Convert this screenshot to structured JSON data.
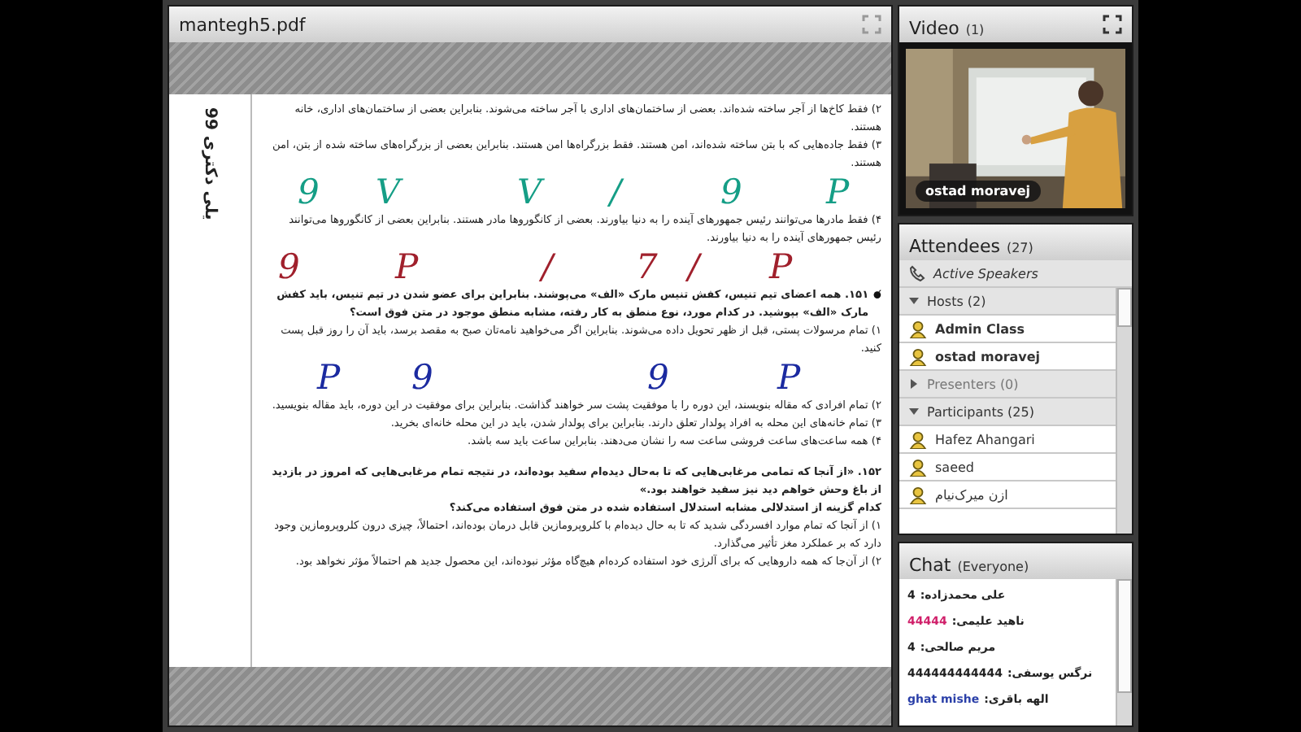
{
  "document": {
    "title": "mantegh5.pdf",
    "side_label": "یلی دکتری 99",
    "lines": [
      {
        "kind": "plain",
        "text": "۲) فقط کاخ‌ها از آجر ساخته شده‌اند. بعضی از ساختمان‌های اداری با آجر ساخته می‌شوند. بنابراین بعضی از ساختمان‌های اداری، خانه هستند."
      },
      {
        "kind": "plain",
        "text": "۳) فقط جاده‌هایی که با بتن ساخته شده‌اند، امن هستند. فقط بزرگراه‌ها امن هستند. بنابراین بعضی از بزرگراه‌های ساخته شده از بتن، امن هستند."
      },
      {
        "kind": "ink",
        "marks": [
          {
            "text": "P",
            "color": "#159e86"
          },
          {
            "text": "9",
            "color": "#159e86"
          },
          {
            "text": "/",
            "color": "#159e86"
          },
          {
            "text": "V",
            "color": "#159e86"
          },
          {
            "text": "V",
            "color": "#159e86"
          },
          {
            "text": "9",
            "color": "#159e86"
          }
        ]
      },
      {
        "kind": "plain",
        "text": "۴) فقط مادرها می‌توانند رئیس جمهورهای آینده را به دنیا بیاورند. بعضی از کانگوروها مادر هستند. بنابراین بعضی از کانگوروها می‌توانند رئیس جمهورهای آینده را به دنیا بیاورند."
      },
      {
        "kind": "ink",
        "marks": [
          {
            "text": "P",
            "color": "#a0202c"
          },
          {
            "text": "/",
            "color": "#a0202c"
          },
          {
            "text": "7",
            "color": "#a0202c"
          },
          {
            "text": "/",
            "color": "#a0202c"
          },
          {
            "text": "P",
            "color": "#a0202c"
          },
          {
            "text": "9",
            "color": "#a0202c"
          }
        ]
      },
      {
        "kind": "question",
        "text": "۱۵۱. همه اعضای تیم تنیس، کفش تنیس مارک «الف» می‌پوشند. بنابراین برای عضو شدن در تیم تنیس، باید کفش مارک «الف» بپوشید. در کدام مورد، نوع منطق به کار رفته، مشابه منطق موجود در متن فوق است؟"
      },
      {
        "kind": "plain",
        "text": "۱) تمام مرسولات پستی، قبل از ظهر تحویل داده می‌شوند. بنابراین اگر می‌خواهید نامه‌تان صبح به مقصد برسد، باید آن را روز قبل پست کنید."
      },
      {
        "kind": "ink",
        "marks": [
          {
            "text": "P",
            "color": "#1b2aa0"
          },
          {
            "text": "9",
            "color": "#1b2aa0"
          },
          {
            "text": "9",
            "color": "#1b2aa0"
          },
          {
            "text": "P",
            "color": "#1b2aa0"
          }
        ]
      },
      {
        "kind": "plain",
        "text": "۲) تمام افرادی که مقاله بنویسند، این دوره را با موفقیت پشت سر خواهند گذاشت. بنابراین برای موفقیت در این دوره، باید مقاله بنویسید."
      },
      {
        "kind": "plain",
        "text": "۳) تمام خانه‌های این محله به افراد پولدار تعلق دارند. بنابراین برای پولدار شدن، باید در این محله خانه‌ای بخرید."
      },
      {
        "kind": "plain",
        "text": "۴) همه ساعت‌های ساعت فروشی ساعت سه را نشان می‌دهند. بنابراین ساعت باید سه باشد."
      },
      {
        "kind": "gap"
      },
      {
        "kind": "bold",
        "text": "۱۵۲. «از آنجا که تمامی مرغابی‌هایی که تا به‌حال دیده‌ام سفید بوده‌اند، در نتیجه تمام مرغابی‌هایی که امروز در بازدید از باغ وحش خواهم دید نیز سفید خواهند بود.»"
      },
      {
        "kind": "bold",
        "text": "کدام گزینه از استدلالی مشابه استدلال استفاده شده در متن فوق استفاده می‌کند؟"
      },
      {
        "kind": "plain",
        "text": "۱) از آنجا که تمام موارد افسردگی شدید که تا به حال دیده‌ام با کلروپرومازین قابل درمان بوده‌اند، احتمالاً، چیزی درون کلروپرومازین وجود دارد که بر عملکرد مغز تأثیر می‌گذارد."
      },
      {
        "kind": "plain",
        "text": "۲) از آن‌جا که همه داروهایی که برای آلرژی خود استفاده کرده‌ام هیچ‌گاه مؤثر نبوده‌اند، این محصول جدید هم احتمالاً مؤثر نخواهد بود."
      }
    ]
  },
  "video": {
    "title": "Video",
    "count": "(1)",
    "speaker": "ostad moravej"
  },
  "attendees": {
    "title": "Attendees",
    "count": "(27)",
    "active_speakers": "Active Speakers",
    "groups": [
      {
        "label": "Hosts (2)",
        "expanded": true,
        "children": [
          {
            "name": "Admin Class",
            "kind": "host"
          },
          {
            "name": "ostad moravej",
            "kind": "host"
          }
        ]
      },
      {
        "label": "Presenters (0)",
        "expanded": false
      },
      {
        "label": "Participants (25)",
        "expanded": true,
        "children": [
          {
            "name": "Hafez Ahangari",
            "kind": "participant"
          },
          {
            "name": "saeed",
            "kind": "participant"
          },
          {
            "name": "ازن میرک‌نیام",
            "kind": "participant"
          }
        ]
      }
    ]
  },
  "chat": {
    "title": "Chat",
    "scope": "(Everyone)",
    "messages": [
      {
        "name": "علی محمدزاده:",
        "text": "4",
        "color": "#222222"
      },
      {
        "name": "ناهید علیمی:",
        "text": "44444",
        "color": "#d0206a"
      },
      {
        "name": "مریم صالحی:",
        "text": "4",
        "color": "#222222"
      },
      {
        "name": "نرگس یوسفی:",
        "text": "444444444444",
        "color": "#222222"
      },
      {
        "name": "الهه باقری:",
        "text": "ghat mishe",
        "color": "#2a3fa8"
      }
    ]
  }
}
